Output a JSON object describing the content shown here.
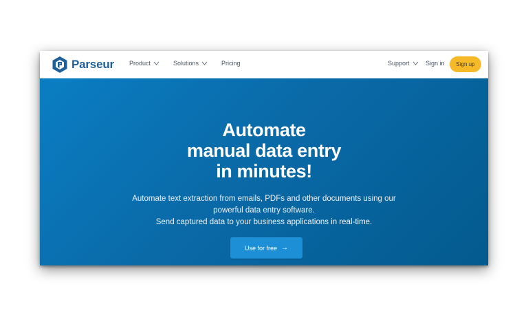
{
  "nav": {
    "brand": "Parseur",
    "items": [
      {
        "label": "Product",
        "has_dropdown": true
      },
      {
        "label": "Solutions",
        "has_dropdown": true
      },
      {
        "label": "Pricing",
        "has_dropdown": false
      }
    ],
    "support_label": "Support",
    "signin_label": "Sign in",
    "signup_label": "Sign up"
  },
  "hero": {
    "headline_lines": [
      "Automate",
      "manual data entry",
      "in minutes!"
    ],
    "subtext_lines": [
      "Automate text extraction from emails, PDFs and other documents using our",
      "powerful data entry software.",
      "Send captured data to your business applications in real-time."
    ],
    "cta_label": "Use for free",
    "cta_icon": "arrow-right-icon"
  },
  "colors": {
    "brand_blue": "#1f5f9a",
    "hero_gradient_start": "#0a7ec3",
    "hero_gradient_end": "#035a8e",
    "signup_yellow": "#f6b928",
    "cta_blue": "#1c8fd6"
  }
}
